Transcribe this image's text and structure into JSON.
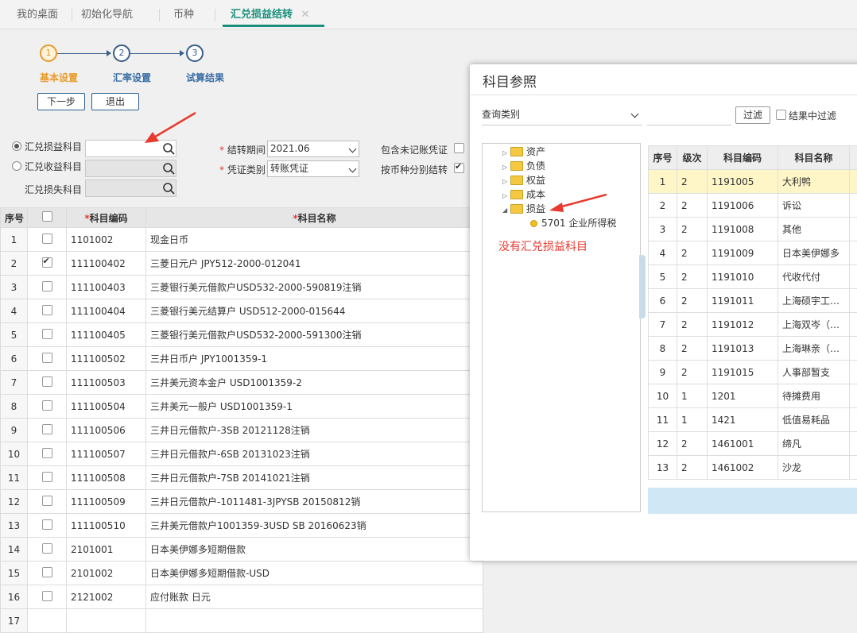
{
  "tabs": [
    {
      "label": "我的桌面"
    },
    {
      "label": "初始化导航"
    },
    {
      "label": "币种"
    },
    {
      "label": "汇兑损益结转"
    }
  ],
  "stepper": {
    "steps": [
      {
        "num": "1",
        "label": "基本设置"
      },
      {
        "num": "2",
        "label": "汇率设置"
      },
      {
        "num": "3",
        "label": "试算结果"
      }
    ]
  },
  "buttons": {
    "next": "下一步",
    "exit": "退出"
  },
  "form": {
    "radio_gain_loss": "汇兑损益科目",
    "radio_gain": "汇兑收益科目",
    "loss_label": "汇兑损失科目",
    "period_label": "结转期间",
    "period_value": "2021.06",
    "voucher_label": "凭证类别",
    "voucher_value": "转账凭证",
    "include_unposted": "包含未记账凭证",
    "by_currency": "按币种分别结转"
  },
  "main_table": {
    "headers": {
      "index": "序号",
      "code": "科目编码",
      "name": "科目名称"
    },
    "rows": [
      {
        "no": "1",
        "code": "1101002",
        "name": "现金日币",
        "checked": false
      },
      {
        "no": "2",
        "code": "111100402",
        "name": "三菱日元户 JPY512-2000-012041",
        "checked": true
      },
      {
        "no": "3",
        "code": "111100403",
        "name": "三菱银行美元借款户USD532-2000-590819注销",
        "checked": false
      },
      {
        "no": "4",
        "code": "111100404",
        "name": "三菱银行美元结算户 USD512-2000-015644",
        "checked": false
      },
      {
        "no": "5",
        "code": "111100405",
        "name": "三菱银行美元借款户USD532-2000-591300注销",
        "checked": false
      },
      {
        "no": "6",
        "code": "111100502",
        "name": "三井日币户 JPY1001359-1",
        "checked": false
      },
      {
        "no": "7",
        "code": "111100503",
        "name": "三井美元资本金户 USD1001359-2",
        "checked": false
      },
      {
        "no": "8",
        "code": "111100504",
        "name": "三井美元一般户 USD1001359-1",
        "checked": false
      },
      {
        "no": "9",
        "code": "111100506",
        "name": "三井日元借款户-3SB 20121128注销",
        "checked": false
      },
      {
        "no": "10",
        "code": "111100507",
        "name": "三井日元借款户-6SB 20131023注销",
        "checked": false
      },
      {
        "no": "11",
        "code": "111100508",
        "name": "三井日元借款户-7SB 20141021注销",
        "checked": false
      },
      {
        "no": "12",
        "code": "111100509",
        "name": "三井日元借款户-1011481-3JPYSB 20150812销",
        "checked": false
      },
      {
        "no": "13",
        "code": "111100510",
        "name": "三井美元借款户1001359-3USD SB 20160623销",
        "checked": false
      },
      {
        "no": "14",
        "code": "2101001",
        "name": "日本美伊娜多短期借款",
        "checked": false
      },
      {
        "no": "15",
        "code": "2101002",
        "name": "日本美伊娜多短期借款-USD",
        "checked": false
      },
      {
        "no": "16",
        "code": "2121002",
        "name": "应付账款 日元",
        "checked": false
      },
      {
        "no": "17",
        "code": "",
        "name": "",
        "checked": false
      }
    ]
  },
  "dialog": {
    "title": "科目参照",
    "query_type": "查询类别",
    "filter_btn": "过滤",
    "filter_in_result": "结果中过滤",
    "tree": [
      {
        "label": "资产",
        "expanded": false
      },
      {
        "label": "负债",
        "expanded": false
      },
      {
        "label": "权益",
        "expanded": false
      },
      {
        "label": "成本",
        "expanded": false
      },
      {
        "label": "损益",
        "expanded": true
      }
    ],
    "tree_child": "5701 企业所得税",
    "annotation": "没有汇兑损益科目",
    "headers": {
      "no": "序号",
      "level": "级次",
      "code": "科目编码",
      "name": "科目名称"
    },
    "rows": [
      {
        "no": "1",
        "level": "2",
        "code": "1191005",
        "name": "大利鸭"
      },
      {
        "no": "2",
        "level": "2",
        "code": "1191006",
        "name": "诉讼"
      },
      {
        "no": "3",
        "level": "2",
        "code": "1191008",
        "name": "其他"
      },
      {
        "no": "4",
        "level": "2",
        "code": "1191009",
        "name": "日本美伊娜多"
      },
      {
        "no": "5",
        "level": "2",
        "code": "1191010",
        "name": "代收代付"
      },
      {
        "no": "6",
        "level": "2",
        "code": "1191011",
        "name": "上海硕宇工…"
      },
      {
        "no": "7",
        "level": "2",
        "code": "1191012",
        "name": "上海双岑（…"
      },
      {
        "no": "8",
        "level": "2",
        "code": "1191013",
        "name": "上海琳亲（…"
      },
      {
        "no": "9",
        "level": "2",
        "code": "1191015",
        "name": "人事部暂支"
      },
      {
        "no": "10",
        "level": "1",
        "code": "1201",
        "name": "待摊费用"
      },
      {
        "no": "11",
        "level": "1",
        "code": "1421",
        "name": "低值易耗品"
      },
      {
        "no": "12",
        "level": "2",
        "code": "1461001",
        "name": "缔凡"
      },
      {
        "no": "13",
        "level": "2",
        "code": "1461002",
        "name": "沙龙"
      }
    ]
  },
  "colors": {
    "accent": "#1a8f7a",
    "step_active": "#e89b2a",
    "step": "#3a5f8a",
    "annotation": "#e83a2f",
    "selected_row": "#fff6c8"
  }
}
